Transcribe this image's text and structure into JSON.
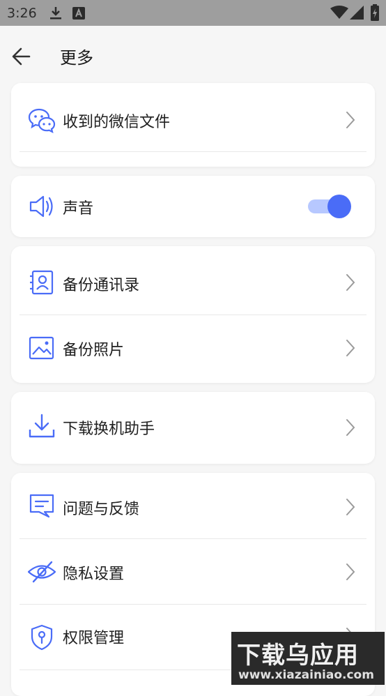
{
  "status_bar": {
    "time": "3:26"
  },
  "header": {
    "title": "更多"
  },
  "cards": {
    "wechat": {
      "label": "收到的微信文件"
    },
    "sound": {
      "label": "声音",
      "toggle_on": true
    },
    "backup": {
      "contacts_label": "备份通讯录",
      "photos_label": "备份照片"
    },
    "download": {
      "label": "下载换机助手"
    },
    "support": {
      "feedback_label": "问题与反馈",
      "privacy_label": "隐私设置",
      "permission_label": "权限管理"
    }
  },
  "watermark": {
    "title": "下载乌应用",
    "url": "www.xiazainiao.com"
  },
  "colors": {
    "accent": "#4a6cf7",
    "track": "#b7c8ff"
  }
}
